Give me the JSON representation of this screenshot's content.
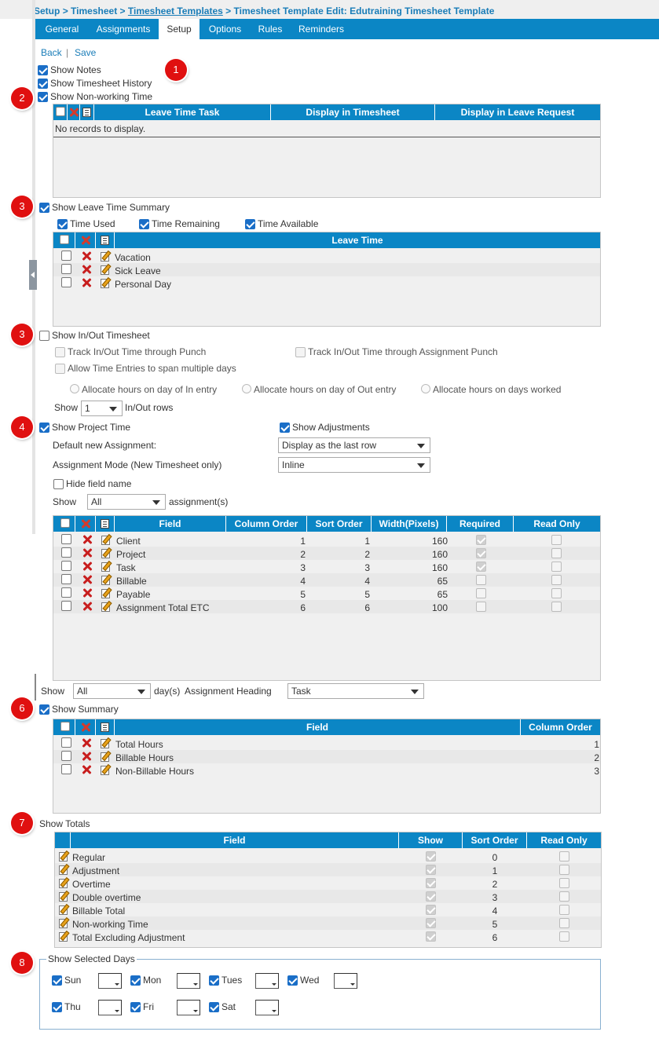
{
  "breadcrumb": {
    "setup": "Setup",
    "sep1": ">",
    "timesheet": "Timesheet",
    "sep2": ">",
    "templates": "Timesheet Templates",
    "sep3": ">",
    "edit": "Timesheet Template Edit: Edutraining Timesheet Template"
  },
  "tabs": [
    "General",
    "Assignments",
    "Setup",
    "Options",
    "Rules",
    "Reminders"
  ],
  "actions": {
    "back": "Back",
    "sep": "|",
    "save": "Save"
  },
  "badges": [
    "1",
    "2",
    "3",
    "3",
    "4",
    "6",
    "7",
    "8"
  ],
  "options": {
    "show_notes": "Show Notes",
    "show_history": "Show Timesheet History",
    "show_nonworking": "Show Non-working Time"
  },
  "nonworking_grid": {
    "columns": [
      "Leave Time Task",
      "Display in Timesheet",
      "Display in Leave Request"
    ],
    "empty": "No records to display."
  },
  "leave_summary": {
    "label": "Show Leave Time Summary",
    "time_used": "Time Used",
    "time_remaining": "Time Remaining",
    "time_available": "Time Available",
    "column": "Leave Time",
    "rows": [
      "Vacation",
      "Sick Leave",
      "Personal Day"
    ]
  },
  "inout": {
    "label": "Show In/Out Timesheet",
    "track_punch": "Track In/Out Time through Punch",
    "track_assignment": "Track In/Out Time through Assignment Punch",
    "span_days": "Allow Time Entries to span multiple days",
    "alloc_in": "Allocate hours on day of In entry",
    "alloc_out": "Allocate hours on day of Out entry",
    "alloc_worked": "Allocate hours on days worked",
    "show": "Show",
    "rows_value": "1",
    "rows_suffix": "In/Out rows"
  },
  "project": {
    "label": "Show Project Time",
    "show_adjustments": "Show Adjustments",
    "default_assignment_label": "Default new Assignment:",
    "default_assignment_value": "Display as the last row",
    "mode_label": "Assignment Mode (New Timesheet only)",
    "mode_value": "Inline",
    "hide_field_name": "Hide field name",
    "show": "Show",
    "show_value": "All",
    "show_suffix": "assignment(s)",
    "columns": [
      "Field",
      "Column Order",
      "Sort Order",
      "Width(Pixels)",
      "Required",
      "Read Only"
    ],
    "rows": [
      {
        "field": "Client",
        "col": "1",
        "sort": "1",
        "width": "160",
        "required": true
      },
      {
        "field": "Project",
        "col": "2",
        "sort": "2",
        "width": "160",
        "required": true
      },
      {
        "field": "Task",
        "col": "3",
        "sort": "3",
        "width": "160",
        "required": true
      },
      {
        "field": "Billable",
        "col": "4",
        "sort": "4",
        "width": "65",
        "required": false
      },
      {
        "field": "Payable",
        "col": "5",
        "sort": "5",
        "width": "65",
        "required": false
      },
      {
        "field": "Assignment Total ETC",
        "col": "6",
        "sort": "6",
        "width": "100",
        "required": false
      }
    ]
  },
  "days_row": {
    "show": "Show",
    "show_value": "All",
    "days_suffix": "day(s)",
    "heading_label": "Assignment Heading",
    "heading_value": "Task"
  },
  "summary": {
    "label": "Show Summary",
    "columns": [
      "Field",
      "Column Order"
    ],
    "rows": [
      {
        "field": "Total Hours",
        "order": "1"
      },
      {
        "field": "Billable Hours",
        "order": "2"
      },
      {
        "field": "Non-Billable Hours",
        "order": "3"
      }
    ]
  },
  "totals": {
    "label": "Show Totals",
    "columns": [
      "Field",
      "Show",
      "Sort Order",
      "Read Only"
    ],
    "rows": [
      {
        "field": "Regular",
        "order": "0"
      },
      {
        "field": "Adjustment",
        "order": "1"
      },
      {
        "field": "Overtime",
        "order": "2"
      },
      {
        "field": "Double overtime",
        "order": "3"
      },
      {
        "field": "Billable Total",
        "order": "4"
      },
      {
        "field": "Non-working Time",
        "order": "5"
      },
      {
        "field": "Total Excluding Adjustment",
        "order": "6"
      }
    ]
  },
  "selected_days": {
    "legend": "Show Selected Days",
    "days": [
      "Sun",
      "Mon",
      "Tues",
      "Wed",
      "Thu",
      "Fri",
      "Sat"
    ]
  },
  "colors": {
    "accent": "#0b86c5",
    "link": "#1a7db8",
    "badge": "#e01010"
  }
}
